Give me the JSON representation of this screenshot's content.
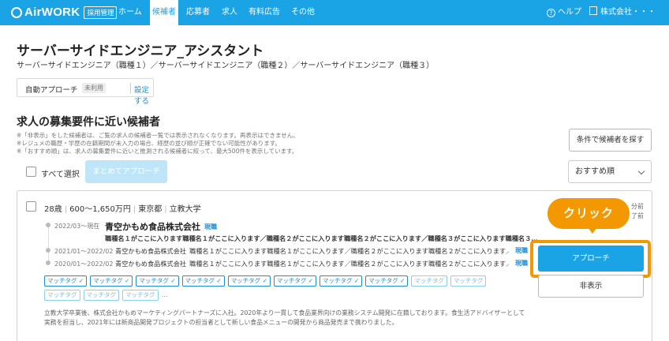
{
  "nav": {
    "logo": "AirWORK",
    "logo_badge": "採用管理",
    "tabs": [
      "ホーム",
      "候補者",
      "応募者",
      "求人",
      "有料広告",
      "その他"
    ],
    "active_tab": "候補者",
    "help": "ヘルプ",
    "company": "株式会社・・・"
  },
  "page": {
    "title": "サーバーサイドエンジニア_アシスタント",
    "subtitle": "サーバーサイドエンジニア（職種１）／サーバーサイドエンジニア（職種２）／サーバーサイドエンジニア（職種３）",
    "auto_approach": {
      "label": "自動アプローチ",
      "status": "未利用",
      "link": "設定する"
    }
  },
  "section": {
    "title": "求人の募集要件に近い候補者",
    "notes": [
      "※「非表示」をした候補者は、ご覧の求人の候補者一覧では表示されなくなります。再表示はできません。",
      "※レジュメの職歴・学歴の在籍期間が未入力の場合、経歴の並び順が正確でない可能性があります。",
      "※「おすすめ順」は、求人の募集要件に近いと推測される候補者に絞って、最大500件を表示しています。"
    ],
    "search_btn": "条件で候補者を探す",
    "select_all": "すべて選択",
    "bulk_btn": "まとめてアプローチ",
    "sort": "おすすめ順"
  },
  "candidate": {
    "age": "28歳",
    "salary": "600〜1,650万円",
    "location": "東京都",
    "school": "立教大学",
    "current": {
      "period": "2022/03〜現在",
      "company": "青空かもめ食品株式会社",
      "badge": "現職",
      "job": "職種名１がここに入ります職種名１がここに入ります／職種名２がここに入ります職種名２がここに入ります／職種名３がここに入ります職種名３…"
    },
    "history": [
      {
        "period": "2021/01〜2022/02",
        "company": "青空かもめ食品株式会社",
        "job": "職種名１がここに入ります職種名１がここに入ります／職種名２がここに入ります職種名２がここに入ります／…",
        "badge": "現職"
      },
      {
        "period": "2020/01〜2022/02",
        "company": "青空かもめ食品株式会社",
        "job": "職種名１がここに入ります職種名１がここに入ります／職種名２がここに入ります職種名２がここに入ります／…",
        "badge": "現職"
      }
    ],
    "tags_matched": [
      "マッチタグ",
      "マッチタグ",
      "マッチタグ",
      "マッチタグ",
      "マッチタグ",
      "マッチタグ",
      "マッチタグ",
      "マッチタグ"
    ],
    "tags_other": [
      "マッチタグ",
      "マッチタグ",
      "マッチタグ",
      "マッチタグ",
      "マッチタグ"
    ],
    "tags_more": "…",
    "pr_text": "立教大学卒業後、株式会社かもめマーケティングパートナーズに入社。2020年より一貫して食品業界向けの業務システム開発に在籍しております。食生活アドバイザーとして実務を担当し、2021年には新商品開発プロジェクトの担当者として新しい食品メニューの開発から商品発売まで携わりました。",
    "time_frag_1": "分前",
    "time_frag_2": "了前",
    "approach_btn": "アプローチ",
    "hide_btn": "非表示"
  },
  "callout": {
    "text": "クリック",
    "color": "#f39800"
  },
  "colors": {
    "brand": "#1aa3e5",
    "link": "#1a8fd6",
    "highlight": "#f39800"
  }
}
